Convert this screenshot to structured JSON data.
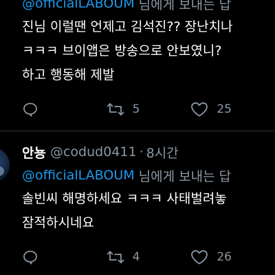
{
  "tweets": [
    {
      "author_name": "",
      "author_handle": "",
      "time_ago": "",
      "reply_to": "@officialLABOUM",
      "reply_suffix": "님에게 보내는 답",
      "body_lines": [
        "진님 이럴땐 언제고 김석진?? 장난치나",
        "ㅋㅋㅋ 브이앱은 방송으로 안보였니? ",
        "하고 행동해 제발"
      ],
      "reply_count": "",
      "retweet_count": "5",
      "like_count": "25"
    },
    {
      "author_name": "안뇽",
      "author_handle": "@codud0411",
      "time_sep": "·",
      "time_ago": "8시간",
      "reply_to": "@officialLABOUM",
      "reply_suffix": "님에게 보내는 답",
      "body_lines": [
        "솔빈씨 해명하세요 ㅋㅋㅋ 사태벌려놓",
        "잠적하시네요"
      ],
      "reply_count": "",
      "retweet_count": "4",
      "like_count": "26"
    }
  ],
  "icons": {
    "reply": "reply-icon",
    "retweet": "retweet-icon",
    "like": "heart-icon"
  },
  "colors": {
    "background": "#000000",
    "mention": "#1d9bf0",
    "muted": "#8b98a5",
    "divider": "#2f3336"
  }
}
